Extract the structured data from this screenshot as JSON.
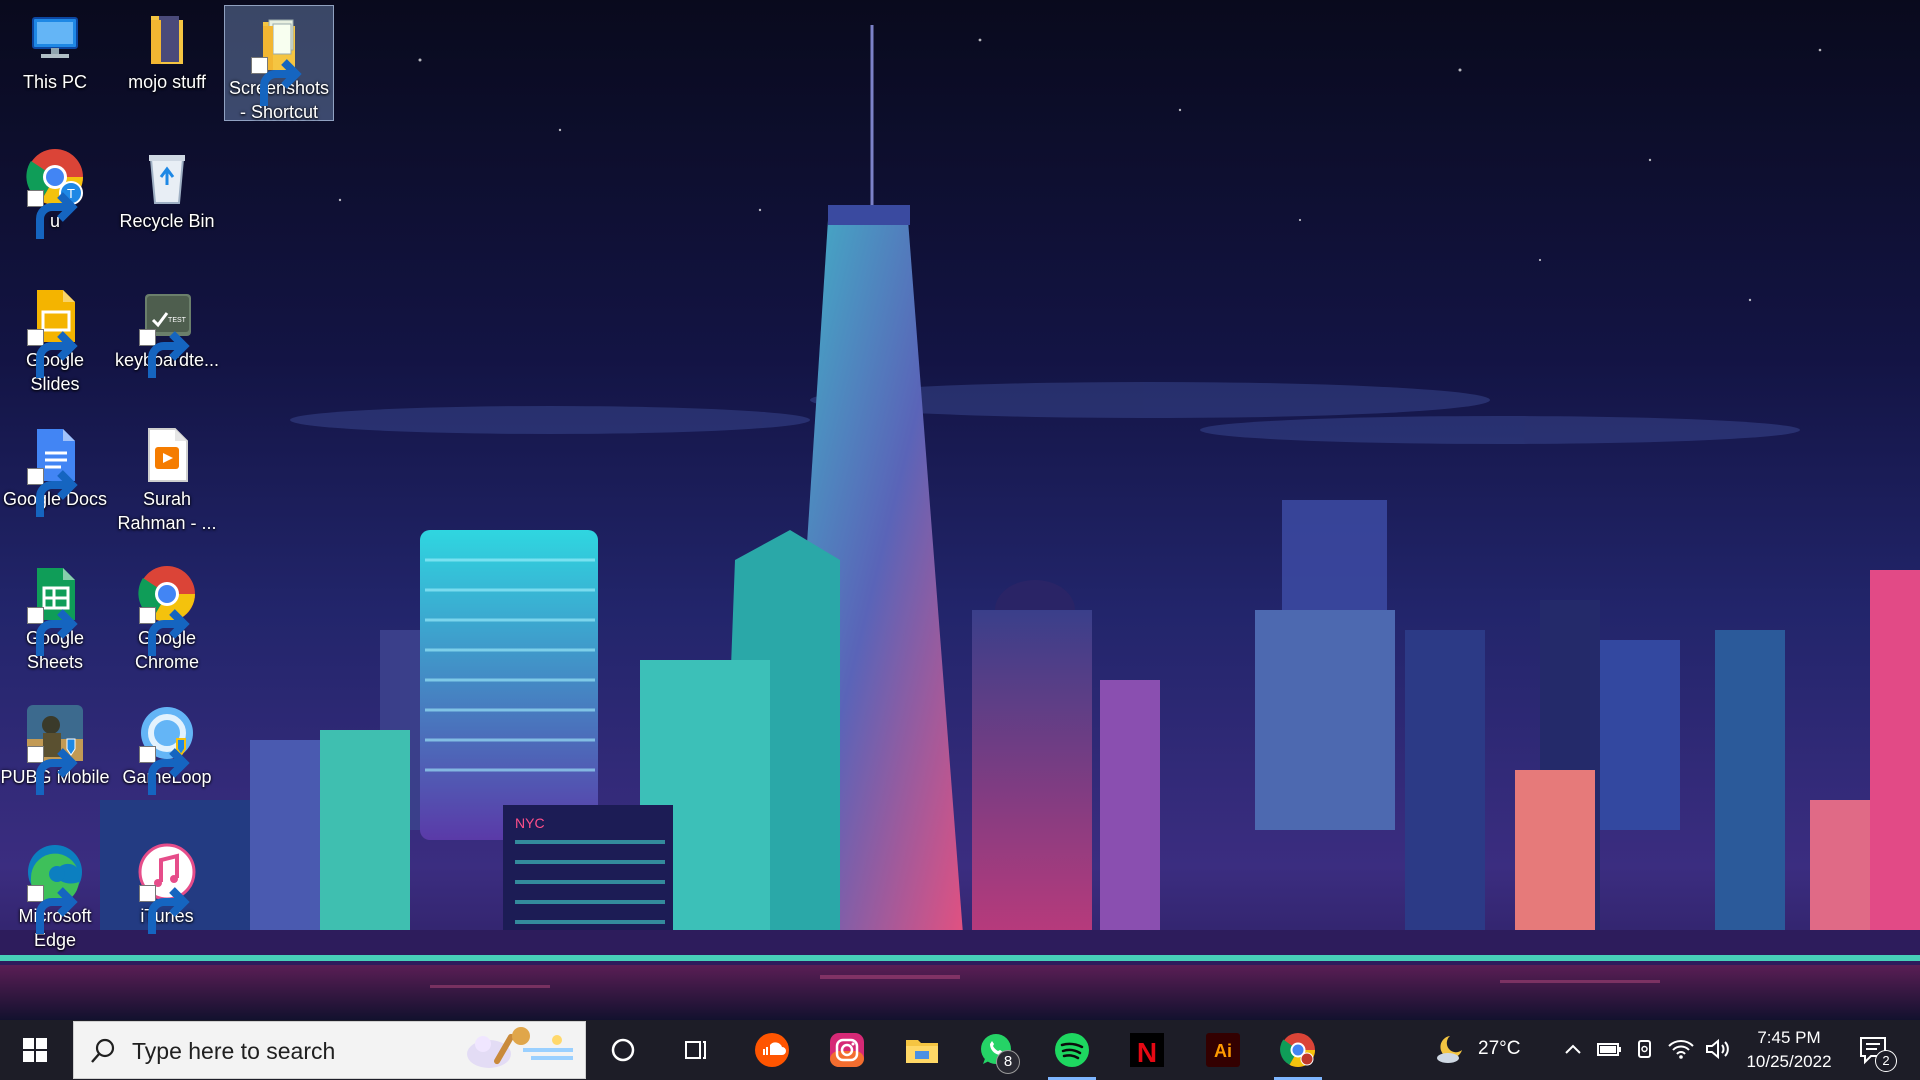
{
  "desktop": {
    "icons": [
      {
        "label": "This PC",
        "icon": "this-pc-icon"
      },
      {
        "label": "mojo stuff",
        "icon": "folder-icon"
      },
      {
        "label": "Screenshots - Shortcut",
        "icon": "folder-shortcut-icon",
        "selected": true
      },
      {
        "label": "u",
        "icon": "chrome-profile-icon",
        "profile_letter": "T"
      },
      {
        "label": "Recycle Bin",
        "icon": "recycle-bin-icon"
      },
      {
        "label": "Google Slides",
        "icon": "google-slides-icon"
      },
      {
        "label": "keyboardte...",
        "icon": "keyboard-test-icon",
        "icon_text": "TEST"
      },
      {
        "label": "Google Docs",
        "icon": "google-docs-icon"
      },
      {
        "label": "Surah Rahman - ...",
        "icon": "media-file-icon"
      },
      {
        "label": "Google Sheets",
        "icon": "google-sheets-icon"
      },
      {
        "label": "Google Chrome",
        "icon": "google-chrome-icon"
      },
      {
        "label": "PUBG Mobile",
        "icon": "pubg-mobile-icon"
      },
      {
        "label": "GameLoop",
        "icon": "gameloop-icon"
      },
      {
        "label": "Microsoft Edge",
        "icon": "microsoft-edge-icon"
      },
      {
        "label": "iTunes",
        "icon": "itunes-icon"
      }
    ],
    "wallpaper_sign": "NYC"
  },
  "taskbar": {
    "search": {
      "placeholder": "Type here to search"
    },
    "pinned": [
      {
        "name": "cortana",
        "icon": "cortana-icon"
      },
      {
        "name": "task-view",
        "icon": "task-view-icon"
      },
      {
        "name": "soundcloud",
        "icon": "soundcloud-icon"
      },
      {
        "name": "instagram",
        "icon": "instagram-icon"
      },
      {
        "name": "file-explorer",
        "icon": "file-explorer-icon"
      },
      {
        "name": "whatsapp",
        "icon": "whatsapp-icon",
        "badge": "8"
      },
      {
        "name": "spotify",
        "icon": "spotify-icon",
        "active": true
      },
      {
        "name": "netflix",
        "icon": "netflix-icon",
        "letter": "N"
      },
      {
        "name": "adobe-illustrator",
        "icon": "adobe-illustrator-icon",
        "letter": "Ai"
      },
      {
        "name": "google-chrome",
        "icon": "google-chrome-icon",
        "active": true
      }
    ],
    "tray": {
      "weather": {
        "temperature": "27°C",
        "icon": "moon-cloud-icon"
      },
      "time": "7:45 PM",
      "date": "10/25/2022",
      "notifications": "2"
    }
  },
  "colors": {
    "taskbar": "#1d1d27",
    "active_indicator": "#7eb6ff",
    "selection": "#8caadc"
  }
}
